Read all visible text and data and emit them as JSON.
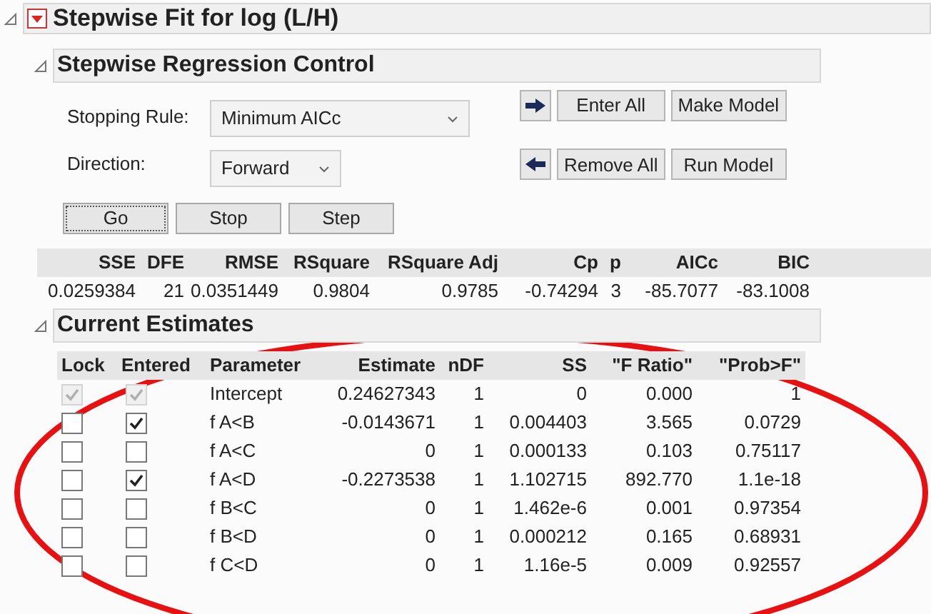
{
  "report": {
    "title": "Stepwise Fit for log (L/H)",
    "expanded": true
  },
  "control": {
    "title": "Stepwise Regression Control",
    "expanded": true,
    "stopping_rule": {
      "label": "Stopping Rule:",
      "value": "Minimum AICc"
    },
    "direction": {
      "label": "Direction:",
      "value": "Forward"
    },
    "buttons": [
      {
        "label": "Go",
        "focused": true
      },
      {
        "label": "Stop",
        "focused": false
      },
      {
        "label": "Step",
        "focused": false
      }
    ],
    "side_buttons": [
      {
        "label": "Enter All"
      },
      {
        "label": "Make Model"
      },
      {
        "label": "Remove All"
      },
      {
        "label": "Run Model"
      }
    ]
  },
  "stats": {
    "columns": [
      "SSE",
      "DFE",
      "RMSE",
      "RSquare",
      "RSquare Adj",
      "Cp",
      "p",
      "AICc",
      "BIC"
    ],
    "values": [
      "0.0259384",
      "21",
      "0.0351449",
      "0.9804",
      "0.9785",
      "-0.74294",
      "3",
      "-85.7077",
      "-83.1008"
    ]
  },
  "estimates": {
    "title": "Current Estimates",
    "expanded": true,
    "columns": [
      "Lock",
      "Entered",
      "Parameter",
      "Estimate",
      "nDF",
      "SS",
      "\"F Ratio\"",
      "\"Prob>F\""
    ],
    "rows": [
      {
        "lock": true,
        "entered": true,
        "disabled": true,
        "parameter": "Intercept",
        "estimate": "0.24627343",
        "ndf": "1",
        "ss": "0",
        "f_ratio": "0.000",
        "prob": "1"
      },
      {
        "lock": false,
        "entered": true,
        "disabled": false,
        "parameter": "f A<B",
        "estimate": "-0.0143671",
        "ndf": "1",
        "ss": "0.004403",
        "f_ratio": "3.565",
        "prob": "0.0729"
      },
      {
        "lock": false,
        "entered": false,
        "disabled": false,
        "parameter": "f A<C",
        "estimate": "0",
        "ndf": "1",
        "ss": "0.000133",
        "f_ratio": "0.103",
        "prob": "0.75117"
      },
      {
        "lock": false,
        "entered": true,
        "disabled": false,
        "parameter": "f A<D",
        "estimate": "-0.2273538",
        "ndf": "1",
        "ss": "1.102715",
        "f_ratio": "892.770",
        "prob": "1.1e-18"
      },
      {
        "lock": false,
        "entered": false,
        "disabled": false,
        "parameter": "f B<C",
        "estimate": "0",
        "ndf": "1",
        "ss": "1.462e-6",
        "f_ratio": "0.001",
        "prob": "0.97354"
      },
      {
        "lock": false,
        "entered": false,
        "disabled": false,
        "parameter": "f B<D",
        "estimate": "0",
        "ndf": "1",
        "ss": "0.000212",
        "f_ratio": "0.165",
        "prob": "0.68931"
      },
      {
        "lock": false,
        "entered": false,
        "disabled": false,
        "parameter": "f C<D",
        "estimate": "0",
        "ndf": "1",
        "ss": "1.16e-5",
        "f_ratio": "0.009",
        "prob": "0.92557"
      }
    ]
  }
}
